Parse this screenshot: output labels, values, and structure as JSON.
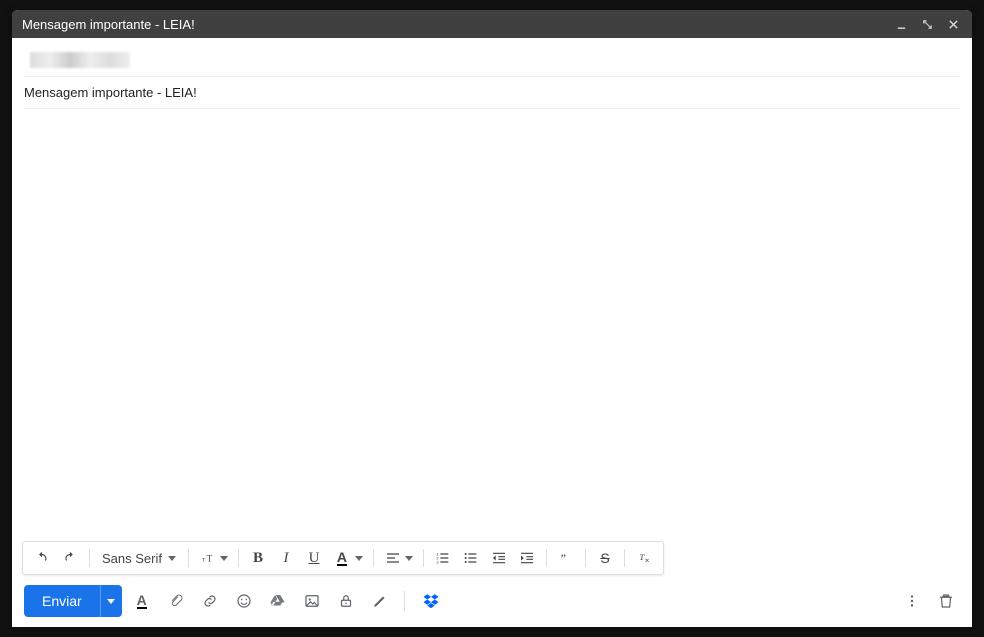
{
  "window": {
    "title": "Mensagem importante - LEIA!"
  },
  "compose": {
    "subject": "Mensagem importante - LEIA!"
  },
  "format_toolbar": {
    "font_family": "Sans Serif"
  },
  "bottom_toolbar": {
    "send_label": "Enviar"
  }
}
